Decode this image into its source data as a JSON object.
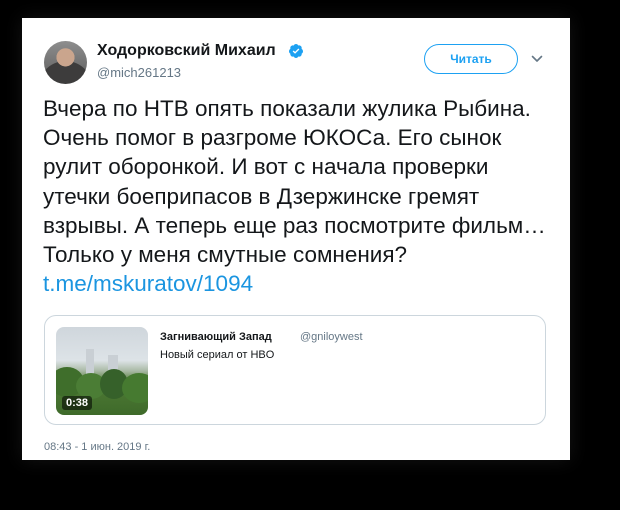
{
  "author": {
    "name": "Ходорковский Михаил",
    "handle": "@mich261213",
    "verified": true
  },
  "follow_button": {
    "label": "Читать"
  },
  "tweet": {
    "text": "Вчера по НТВ опять показали жулика Рыбина. Очень помог в разгроме ЮКОСа. Его сынок рулит оборонкой. И вот с начала проверки утечки боеприпасов в Дзержинске гремят взрывы. А теперь еще раз посмотрите фильм… Только у меня смутные сомнения?",
    "link": "t.me/mskuratov/1094"
  },
  "quoted_tweet": {
    "name": "Загнивающий Запад",
    "handle": "@gniloywest",
    "text": "Новый сериал от HBO",
    "video_duration": "0:38"
  },
  "timestamp": "08:43 - 1 июн. 2019 г.",
  "colors": {
    "accent": "#1da1f2",
    "link": "#1b95e0",
    "text": "#14171a",
    "secondary": "#657786",
    "border": "#ccd6dd",
    "page_background": "#000000"
  },
  "icons": {
    "verified": "verified-badge-icon",
    "menu": "chevron-down-icon"
  }
}
